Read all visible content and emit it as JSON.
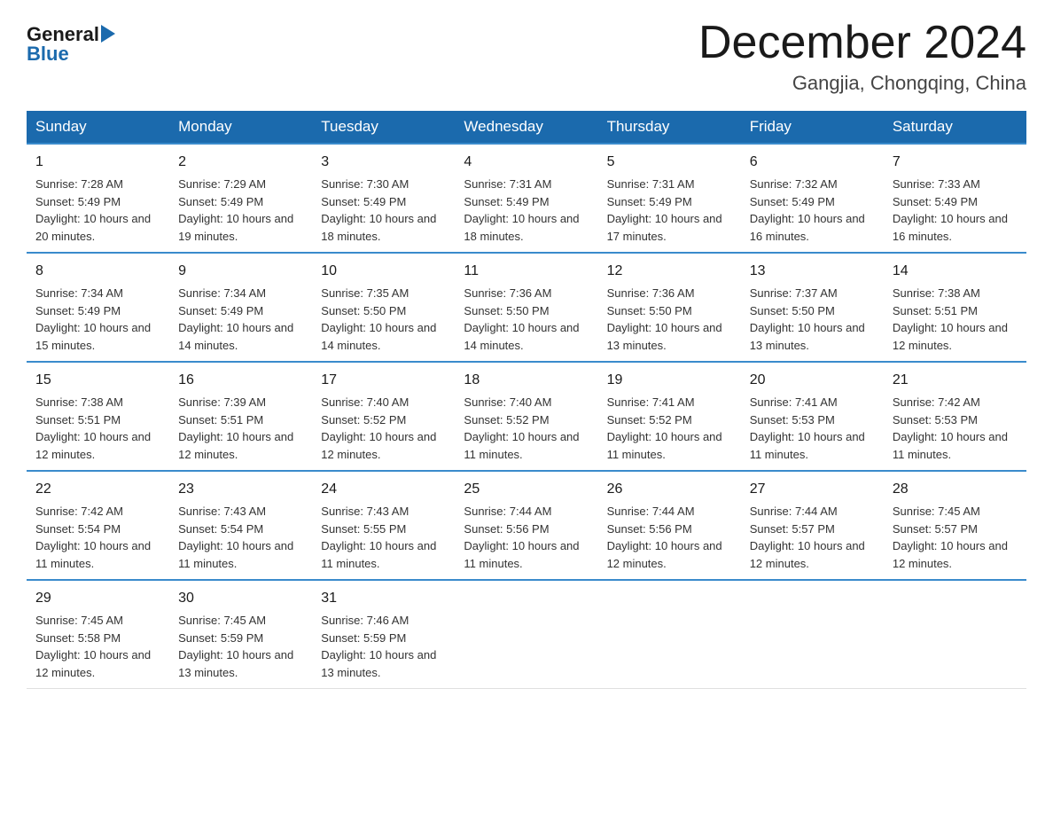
{
  "header": {
    "logo_general": "General",
    "logo_blue": "Blue",
    "month_title": "December 2024",
    "location": "Gangjia, Chongqing, China"
  },
  "days_of_week": [
    "Sunday",
    "Monday",
    "Tuesday",
    "Wednesday",
    "Thursday",
    "Friday",
    "Saturday"
  ],
  "weeks": [
    [
      {
        "day": "1",
        "sunrise": "7:28 AM",
        "sunset": "5:49 PM",
        "daylight": "10 hours and 20 minutes."
      },
      {
        "day": "2",
        "sunrise": "7:29 AM",
        "sunset": "5:49 PM",
        "daylight": "10 hours and 19 minutes."
      },
      {
        "day": "3",
        "sunrise": "7:30 AM",
        "sunset": "5:49 PM",
        "daylight": "10 hours and 18 minutes."
      },
      {
        "day": "4",
        "sunrise": "7:31 AM",
        "sunset": "5:49 PM",
        "daylight": "10 hours and 18 minutes."
      },
      {
        "day": "5",
        "sunrise": "7:31 AM",
        "sunset": "5:49 PM",
        "daylight": "10 hours and 17 minutes."
      },
      {
        "day": "6",
        "sunrise": "7:32 AM",
        "sunset": "5:49 PM",
        "daylight": "10 hours and 16 minutes."
      },
      {
        "day": "7",
        "sunrise": "7:33 AM",
        "sunset": "5:49 PM",
        "daylight": "10 hours and 16 minutes."
      }
    ],
    [
      {
        "day": "8",
        "sunrise": "7:34 AM",
        "sunset": "5:49 PM",
        "daylight": "10 hours and 15 minutes."
      },
      {
        "day": "9",
        "sunrise": "7:34 AM",
        "sunset": "5:49 PM",
        "daylight": "10 hours and 14 minutes."
      },
      {
        "day": "10",
        "sunrise": "7:35 AM",
        "sunset": "5:50 PM",
        "daylight": "10 hours and 14 minutes."
      },
      {
        "day": "11",
        "sunrise": "7:36 AM",
        "sunset": "5:50 PM",
        "daylight": "10 hours and 14 minutes."
      },
      {
        "day": "12",
        "sunrise": "7:36 AM",
        "sunset": "5:50 PM",
        "daylight": "10 hours and 13 minutes."
      },
      {
        "day": "13",
        "sunrise": "7:37 AM",
        "sunset": "5:50 PM",
        "daylight": "10 hours and 13 minutes."
      },
      {
        "day": "14",
        "sunrise": "7:38 AM",
        "sunset": "5:51 PM",
        "daylight": "10 hours and 12 minutes."
      }
    ],
    [
      {
        "day": "15",
        "sunrise": "7:38 AM",
        "sunset": "5:51 PM",
        "daylight": "10 hours and 12 minutes."
      },
      {
        "day": "16",
        "sunrise": "7:39 AM",
        "sunset": "5:51 PM",
        "daylight": "10 hours and 12 minutes."
      },
      {
        "day": "17",
        "sunrise": "7:40 AM",
        "sunset": "5:52 PM",
        "daylight": "10 hours and 12 minutes."
      },
      {
        "day": "18",
        "sunrise": "7:40 AM",
        "sunset": "5:52 PM",
        "daylight": "10 hours and 11 minutes."
      },
      {
        "day": "19",
        "sunrise": "7:41 AM",
        "sunset": "5:52 PM",
        "daylight": "10 hours and 11 minutes."
      },
      {
        "day": "20",
        "sunrise": "7:41 AM",
        "sunset": "5:53 PM",
        "daylight": "10 hours and 11 minutes."
      },
      {
        "day": "21",
        "sunrise": "7:42 AM",
        "sunset": "5:53 PM",
        "daylight": "10 hours and 11 minutes."
      }
    ],
    [
      {
        "day": "22",
        "sunrise": "7:42 AM",
        "sunset": "5:54 PM",
        "daylight": "10 hours and 11 minutes."
      },
      {
        "day": "23",
        "sunrise": "7:43 AM",
        "sunset": "5:54 PM",
        "daylight": "10 hours and 11 minutes."
      },
      {
        "day": "24",
        "sunrise": "7:43 AM",
        "sunset": "5:55 PM",
        "daylight": "10 hours and 11 minutes."
      },
      {
        "day": "25",
        "sunrise": "7:44 AM",
        "sunset": "5:56 PM",
        "daylight": "10 hours and 11 minutes."
      },
      {
        "day": "26",
        "sunrise": "7:44 AM",
        "sunset": "5:56 PM",
        "daylight": "10 hours and 12 minutes."
      },
      {
        "day": "27",
        "sunrise": "7:44 AM",
        "sunset": "5:57 PM",
        "daylight": "10 hours and 12 minutes."
      },
      {
        "day": "28",
        "sunrise": "7:45 AM",
        "sunset": "5:57 PM",
        "daylight": "10 hours and 12 minutes."
      }
    ],
    [
      {
        "day": "29",
        "sunrise": "7:45 AM",
        "sunset": "5:58 PM",
        "daylight": "10 hours and 12 minutes."
      },
      {
        "day": "30",
        "sunrise": "7:45 AM",
        "sunset": "5:59 PM",
        "daylight": "10 hours and 13 minutes."
      },
      {
        "day": "31",
        "sunrise": "7:46 AM",
        "sunset": "5:59 PM",
        "daylight": "10 hours and 13 minutes."
      },
      null,
      null,
      null,
      null
    ]
  ]
}
